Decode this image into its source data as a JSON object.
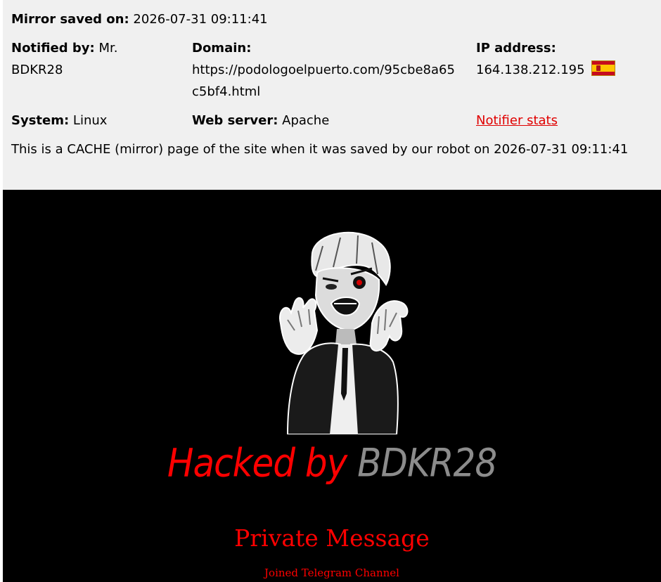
{
  "mirror_info": {
    "saved_label": "Mirror saved on:",
    "saved_value": "2026-07-31 09:11:41",
    "notified_label": "Notified by:",
    "notified_value": "Mr. BDKR28",
    "domain_label": "Domain:",
    "domain_value": "https://podologoelpuerto.com/95cbe8a65c5bf4.html",
    "ip_label": "IP address:",
    "ip_value": "164.138.212.195",
    "ip_flag": "spain-flag-icon",
    "system_label": "System:",
    "system_value": "Linux",
    "webserver_label": "Web server:",
    "webserver_value": "Apache",
    "notifier_stats_link": "Notifier stats",
    "cache_note": "This is a CACHE (mirror) page of the site when it was saved by our robot on 2026-07-31 09:11:41"
  },
  "mirror_page": {
    "hero_image": "anime-character-illustration",
    "title_part1": "Hacked by",
    "title_part2": "BDKR28",
    "private_message": "Private Message",
    "telegram_link": "Joined Telegram Channel",
    "colors": {
      "background": "#000000",
      "accent_red": "#ff0000",
      "grey": "#8c8c8c",
      "link_red": "#e00000",
      "info_bg": "#f0f0f0"
    }
  }
}
